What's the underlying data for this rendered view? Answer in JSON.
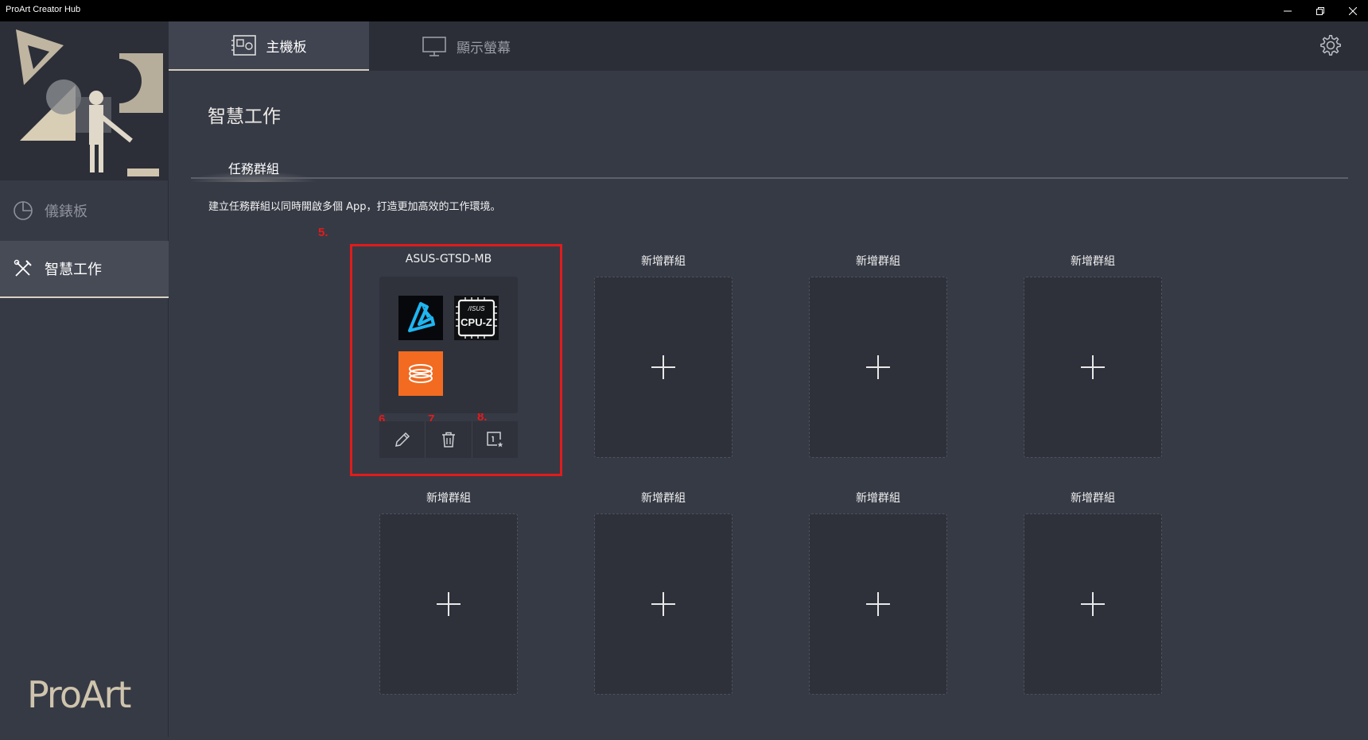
{
  "window": {
    "title": "ProArt Creator Hub"
  },
  "sidebar": {
    "items": [
      {
        "label": "儀錶板",
        "icon": "pie-chart-icon",
        "active": false
      },
      {
        "label": "智慧工作",
        "icon": "tools-icon",
        "active": true
      }
    ],
    "logo": "ProArt"
  },
  "topbar": {
    "tabs": [
      {
        "label": "主機板",
        "icon": "motherboard-icon",
        "active": true
      },
      {
        "label": "顯示螢幕",
        "icon": "monitor-icon",
        "active": false
      }
    ],
    "settings_icon": "gear-icon"
  },
  "content": {
    "title": "智慧工作",
    "subtab": "任務群組",
    "description": "建立任務群組以同時開啟多個 App，打造更加高效的工作環境。"
  },
  "annotations": [
    "5.",
    "6.",
    "7.",
    "8."
  ],
  "groups": [
    {
      "name": "ASUS-GTSD-MB",
      "filled": true,
      "apps": [
        "armoury-app-icon",
        "cpu-z-app-icon",
        "orange-app-icon"
      ]
    },
    {
      "name": "新增群組",
      "filled": false
    },
    {
      "name": "新增群組",
      "filled": false
    },
    {
      "name": "新增群組",
      "filled": false
    },
    {
      "name": "新增群組",
      "filled": false
    },
    {
      "name": "新增群組",
      "filled": false
    },
    {
      "name": "新增群組",
      "filled": false
    },
    {
      "name": "新增群組",
      "filled": false
    }
  ],
  "group_actions": [
    {
      "icon": "pencil-icon",
      "action": "edit"
    },
    {
      "icon": "trash-icon",
      "action": "delete"
    },
    {
      "icon": "launch-icon",
      "action": "launch"
    }
  ],
  "cpuz_label": "CPU-Z",
  "asus_label": "/ISUS",
  "colors": {
    "background": "#363a45",
    "topbar": "#2b2e37",
    "accent": "#d3cdbd",
    "highlight": "#e01c1c",
    "orange_app": "#f26b21"
  }
}
